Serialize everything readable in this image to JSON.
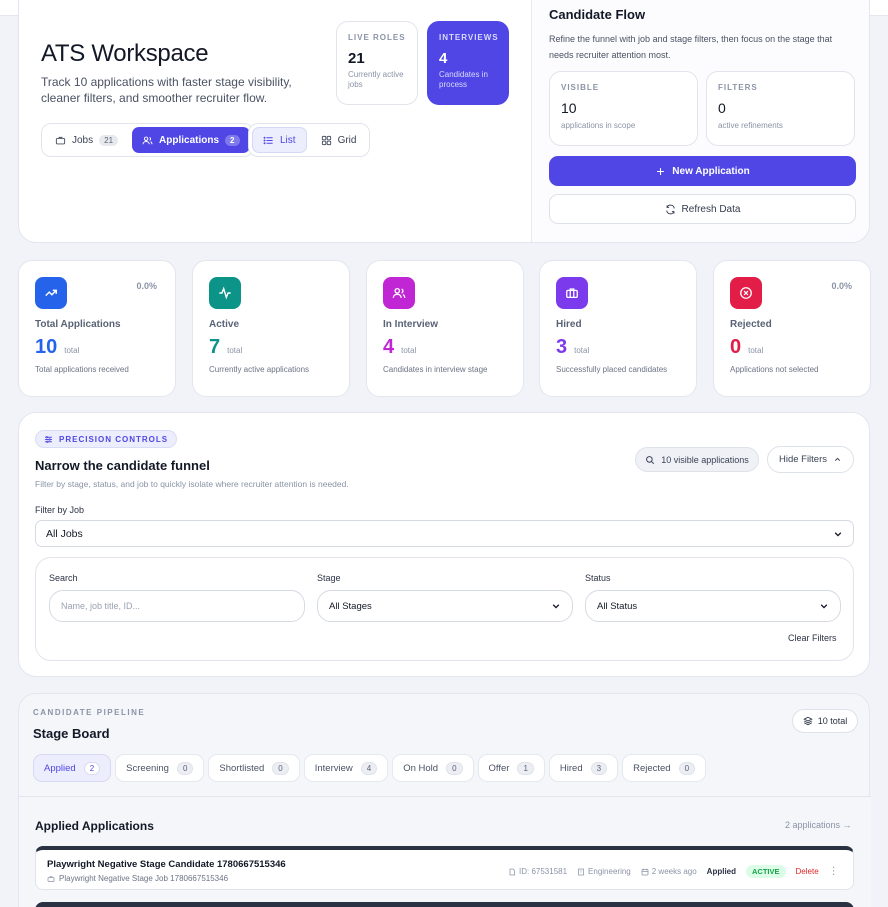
{
  "hero": {
    "title": "ATS Workspace",
    "subtitle": "Track 10 applications with faster stage visibility, cleaner filters, and smoother recruiter flow.",
    "live_roles": {
      "label": "LIVE ROLES",
      "value": "21",
      "caption": "Currently active jobs"
    },
    "interviews": {
      "label": "INTERVIEWS",
      "value": "4",
      "caption": "Candidates in process"
    },
    "view_tabs": [
      {
        "label": "Jobs",
        "count": "21",
        "icon": "briefcase-icon"
      },
      {
        "label": "Applications",
        "count": "2",
        "icon": "users-icon"
      }
    ],
    "layout_tabs": [
      {
        "label": "List",
        "icon": "list-icon"
      },
      {
        "label": "Grid",
        "icon": "grid-icon"
      }
    ]
  },
  "flow": {
    "title": "Candidate Flow",
    "description": "Refine the funnel with job and stage filters, then focus on the stage that needs recruiter attention most.",
    "visible": {
      "label": "VISIBLE",
      "value": "10",
      "caption": "applications in scope"
    },
    "filters": {
      "label": "FILTERS",
      "value": "0",
      "caption": "active refinements"
    },
    "new_button": "New Application",
    "refresh_button": "Refresh Data"
  },
  "kpis": [
    {
      "title": "Total Applications",
      "value": "10",
      "unit": "total",
      "caption": "Total applications received",
      "pct": "0.0%",
      "color": "#2563eb",
      "icon": "trend-up-icon"
    },
    {
      "title": "Active",
      "value": "7",
      "unit": "total",
      "caption": "Currently active applications",
      "pct": "",
      "color": "#0d9488",
      "icon": "activity-icon"
    },
    {
      "title": "In Interview",
      "value": "4",
      "unit": "total",
      "caption": "Candidates in interview stage",
      "pct": "",
      "color": "#c026d3",
      "icon": "users-icon"
    },
    {
      "title": "Hired",
      "value": "3",
      "unit": "total",
      "caption": "Successfully placed candidates",
      "pct": "",
      "color": "#7c3aed",
      "icon": "briefcase-icon"
    },
    {
      "title": "Rejected",
      "value": "0",
      "unit": "total",
      "caption": "Applications not selected",
      "pct": "0.0%",
      "color": "#e11d48",
      "icon": "x-circle-icon"
    }
  ],
  "filters": {
    "chip": "PRECISION CONTROLS",
    "title": "Narrow the candidate funnel",
    "description": "Filter by stage, status, and job to quickly isolate where recruiter attention is needed.",
    "visible_pill": "10 visible applications",
    "hide_button": "Hide Filters",
    "job_label": "Filter by Job",
    "job_value": "All Jobs",
    "search_label": "Search",
    "search_placeholder": "Name, job title, ID...",
    "stage_label": "Stage",
    "stage_value": "All Stages",
    "status_label": "Status",
    "status_value": "All Status",
    "clear": "Clear Filters"
  },
  "pipeline": {
    "kicker": "CANDIDATE PIPELINE",
    "title": "Stage Board",
    "total": "10 total",
    "tabs": [
      {
        "label": "Applied",
        "count": "2"
      },
      {
        "label": "Screening",
        "count": "0"
      },
      {
        "label": "Shortlisted",
        "count": "0"
      },
      {
        "label": "Interview",
        "count": "4"
      },
      {
        "label": "On Hold",
        "count": "0"
      },
      {
        "label": "Offer",
        "count": "1"
      },
      {
        "label": "Hired",
        "count": "3"
      },
      {
        "label": "Rejected",
        "count": "0"
      }
    ],
    "applied_title": "Applied Applications",
    "applied_link": "2 applications →",
    "row": {
      "name": "Playwright Negative Stage Candidate 1780667515346",
      "job": "Playwright Negative Stage Job 1780667515346",
      "id": "ID: 67531581",
      "department": "Engineering",
      "time": "2 weeks ago",
      "stage": "Applied",
      "status": "ACTIVE",
      "delete": "Delete"
    }
  }
}
